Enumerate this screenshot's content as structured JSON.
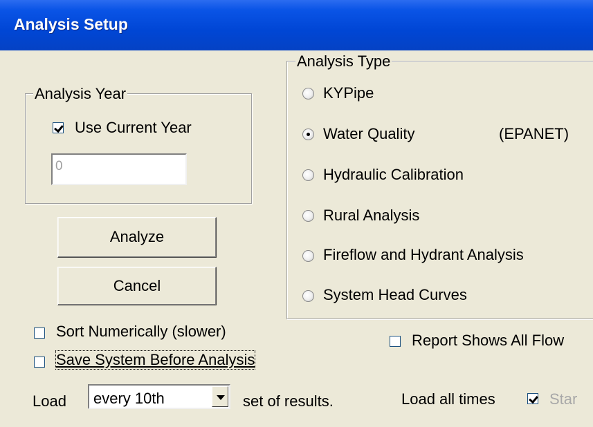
{
  "window": {
    "title": "Analysis Setup"
  },
  "analysis_year": {
    "legend": "Analysis Year",
    "use_current_year": {
      "label": "Use Current Year",
      "checked": true
    },
    "year_value": "0"
  },
  "buttons": {
    "analyze": "Analyze",
    "cancel": "Cancel"
  },
  "options": {
    "sort_numerically": {
      "label": "Sort Numerically (slower)",
      "checked": false
    },
    "save_system": {
      "label": "Save System Before Analysis",
      "checked": false
    },
    "report_all_flows": {
      "label": "Report Shows All Flow",
      "checked": false
    }
  },
  "load": {
    "prefix": "Load",
    "selected": "every 10th",
    "suffix": "set of results.",
    "all_times_label": "Load all times",
    "all_times_checked": true,
    "start_label": "Star"
  },
  "analysis_type": {
    "legend": "Analysis Type",
    "options": [
      {
        "label": "KYPipe",
        "selected": false
      },
      {
        "label": "Water Quality",
        "selected": true,
        "note": "(EPANET)"
      },
      {
        "label": "Hydraulic Calibration",
        "selected": false
      },
      {
        "label": "Rural Analysis",
        "selected": false
      },
      {
        "label": "Fireflow and Hydrant Analysis",
        "selected": false
      },
      {
        "label": "System Head Curves",
        "selected": false
      }
    ]
  }
}
